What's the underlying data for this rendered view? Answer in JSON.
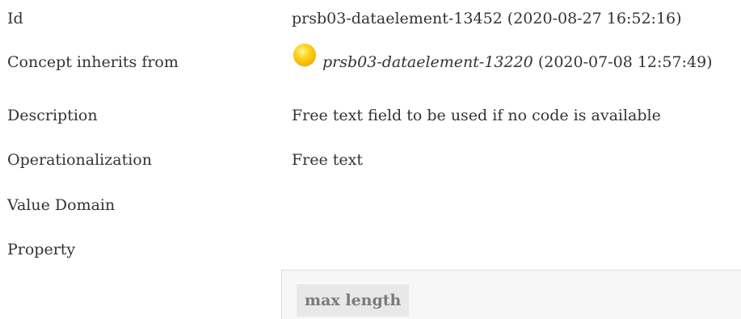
{
  "rows": [
    {
      "label": "Id",
      "value": "prsb03-dataelement-13452 (2020-08-27 16:52:16)"
    },
    {
      "label": "Concept inherits from",
      "link": "prsb03-dataelement-13220",
      "suffix": " (2020-07-08 12:57:49)"
    },
    {
      "label": "Description",
      "value": "Free text field to be used if no code is available"
    },
    {
      "label": "Operationalization",
      "value": "Free text"
    },
    {
      "label": "Value Domain"
    },
    {
      "label": "Property"
    }
  ],
  "property": {
    "tag": "max length"
  },
  "icons": {
    "inherit_icon": "yellow-orb-icon"
  },
  "colors": {
    "text": "#333333",
    "orb": "#f5b400",
    "property_bg": "#f7f7f7",
    "tag_bg": "#e8e8e8"
  }
}
